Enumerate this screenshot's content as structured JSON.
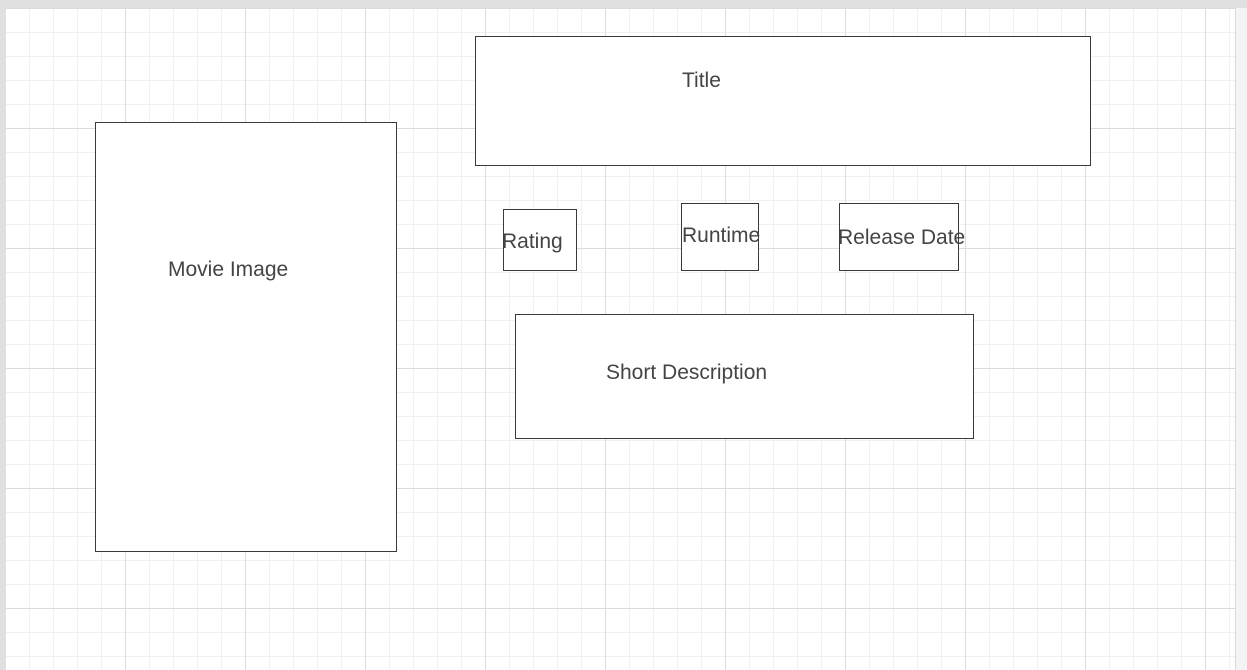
{
  "diagram": {
    "title_box": {
      "label": "Title"
    },
    "movie_image_box": {
      "label": "Movie Image"
    },
    "rating_box": {
      "label": "Rating"
    },
    "runtime_box": {
      "label": "Runtime"
    },
    "release_date_box": {
      "label": "Release Date"
    },
    "short_description_box": {
      "label": "Short Description"
    }
  }
}
